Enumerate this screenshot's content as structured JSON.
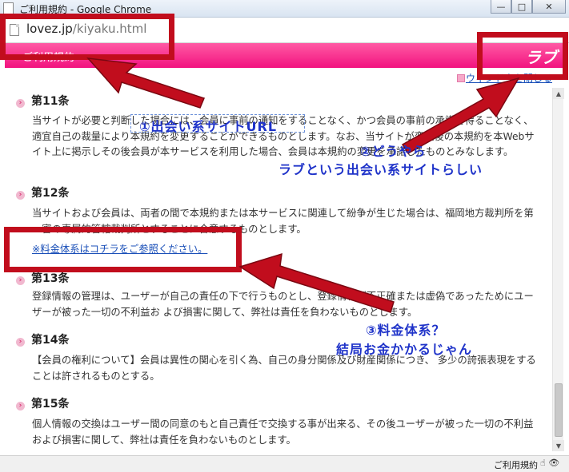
{
  "window": {
    "title": "ご利用規約 - Google Chrome",
    "minimize_label": "—",
    "maximize_label": "□",
    "close_label": "✕"
  },
  "address": {
    "host": "lovez.jp",
    "path": "/kiyaku.html"
  },
  "page": {
    "header_label": "ご利用規約",
    "logo_text": "ラブ",
    "close_window_link": "ウィンドウを閉じる",
    "sections": [
      {
        "title": "第11条",
        "body": "当サイトが必要と判断した場合には、会員に事前の通知をすることなく、かつ会員の事前の承諾を得ることなく、適宜自己の裁量により本規約を変更することができるものとします。なお、当サイトが変更後の本規約を本Webサイト上に掲示しその後会員が本サービスを利用した場合、会員は本規約の変更を承諾したものとみなします。"
      },
      {
        "title": "第12条",
        "body": "当サイトおよび会員は、両者の間で本規約または本サービスに関連して紛争が生じた場合は、福岡地方裁判所を第一審の専属的管轄裁判所とすることに合意するものとします。"
      },
      {
        "title": "第13条",
        "body": "登録情報の管理は、ユーザーが自己の責任の下で行うものとし、登録情報が不正確または虚偽であったためにユーザーが被った一切の不利益お よび損害に関して、弊社は責任を負わないものとします。"
      },
      {
        "title": "第14条",
        "body": "【会員の権利について】会員は異性の関心を引く為、自己の身分関係及び財産関係につき、 多少の誇張表現をすることは許されるものとする。"
      },
      {
        "title": "第15条",
        "body": "個人情報の交換はユーザー間の同意のもと自己責任で交換する事が出来る、その後ユーザーが被った一切の不利益および損害に関して、弊社は責任を負わないものとします。"
      }
    ],
    "fee_link": "※料金体系はコチラをご参照ください。"
  },
  "statusbar": {
    "text": "ご利用規約",
    "icons": "☝ 👁"
  },
  "annotations": {
    "note1": "①出会い系サイトURL",
    "note2_line1": "②どうやら",
    "note2_line2": "ラブという出会い系サイトらしい",
    "note3_line1": "③料金体系？",
    "note3_line2": "結局お金かかるじゃん",
    "annotation_color": "#c10d1d",
    "text_color": "#1f33c9"
  },
  "colors": {
    "header_pink": "#f2127f",
    "link_blue": "#1a4fb8"
  }
}
